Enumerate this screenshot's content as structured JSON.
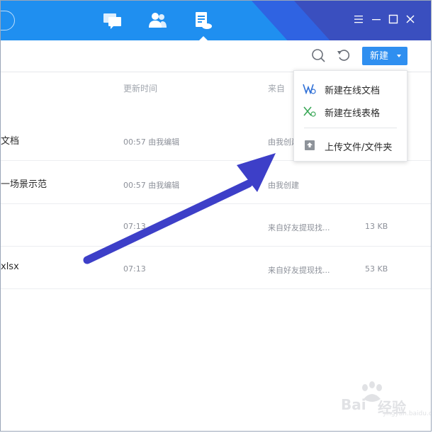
{
  "colors": {
    "topbar": "#1f8ff0",
    "accent": "#2f8ff0",
    "arrow": "#3d3fc8",
    "word_icon": "#2e6fd6",
    "excel_icon": "#3aa757"
  },
  "nav": {
    "icons": [
      "chat-icon",
      "contacts-icon",
      "documents-icon"
    ],
    "active": "documents-icon"
  },
  "window_controls": [
    "menu-icon",
    "minimize-icon",
    "maximize-icon",
    "close-icon"
  ],
  "toolbar": {
    "new_label": "新建",
    "icons": [
      "search-icon",
      "refresh-icon"
    ]
  },
  "columns": {
    "updated": "更新时间",
    "source": "来自"
  },
  "rows": [
    {
      "name": "文档",
      "time": "00:57  由我编辑",
      "source": "由我创建",
      "size": ""
    },
    {
      "name": "一场景示范",
      "time": "00:57  由我编辑",
      "source": "由我创建",
      "size": ""
    },
    {
      "name": "",
      "time": "07:13",
      "source": "来自好友提现找...",
      "size": "13 KB"
    },
    {
      "name": "xlsx",
      "time": "07:13",
      "source": "来自好友提现找...",
      "size": "53 KB"
    }
  ],
  "dropdown": {
    "items": [
      {
        "label": "新建在线文档",
        "icon": "online-doc-icon"
      },
      {
        "label": "新建在线表格",
        "icon": "online-sheet-icon"
      },
      {
        "label": "上传文件/文件夹",
        "icon": "upload-icon"
      }
    ]
  },
  "watermark": {
    "text": "Bai",
    "sub": "jingyan.baidu.com",
    "brand": "经验"
  }
}
